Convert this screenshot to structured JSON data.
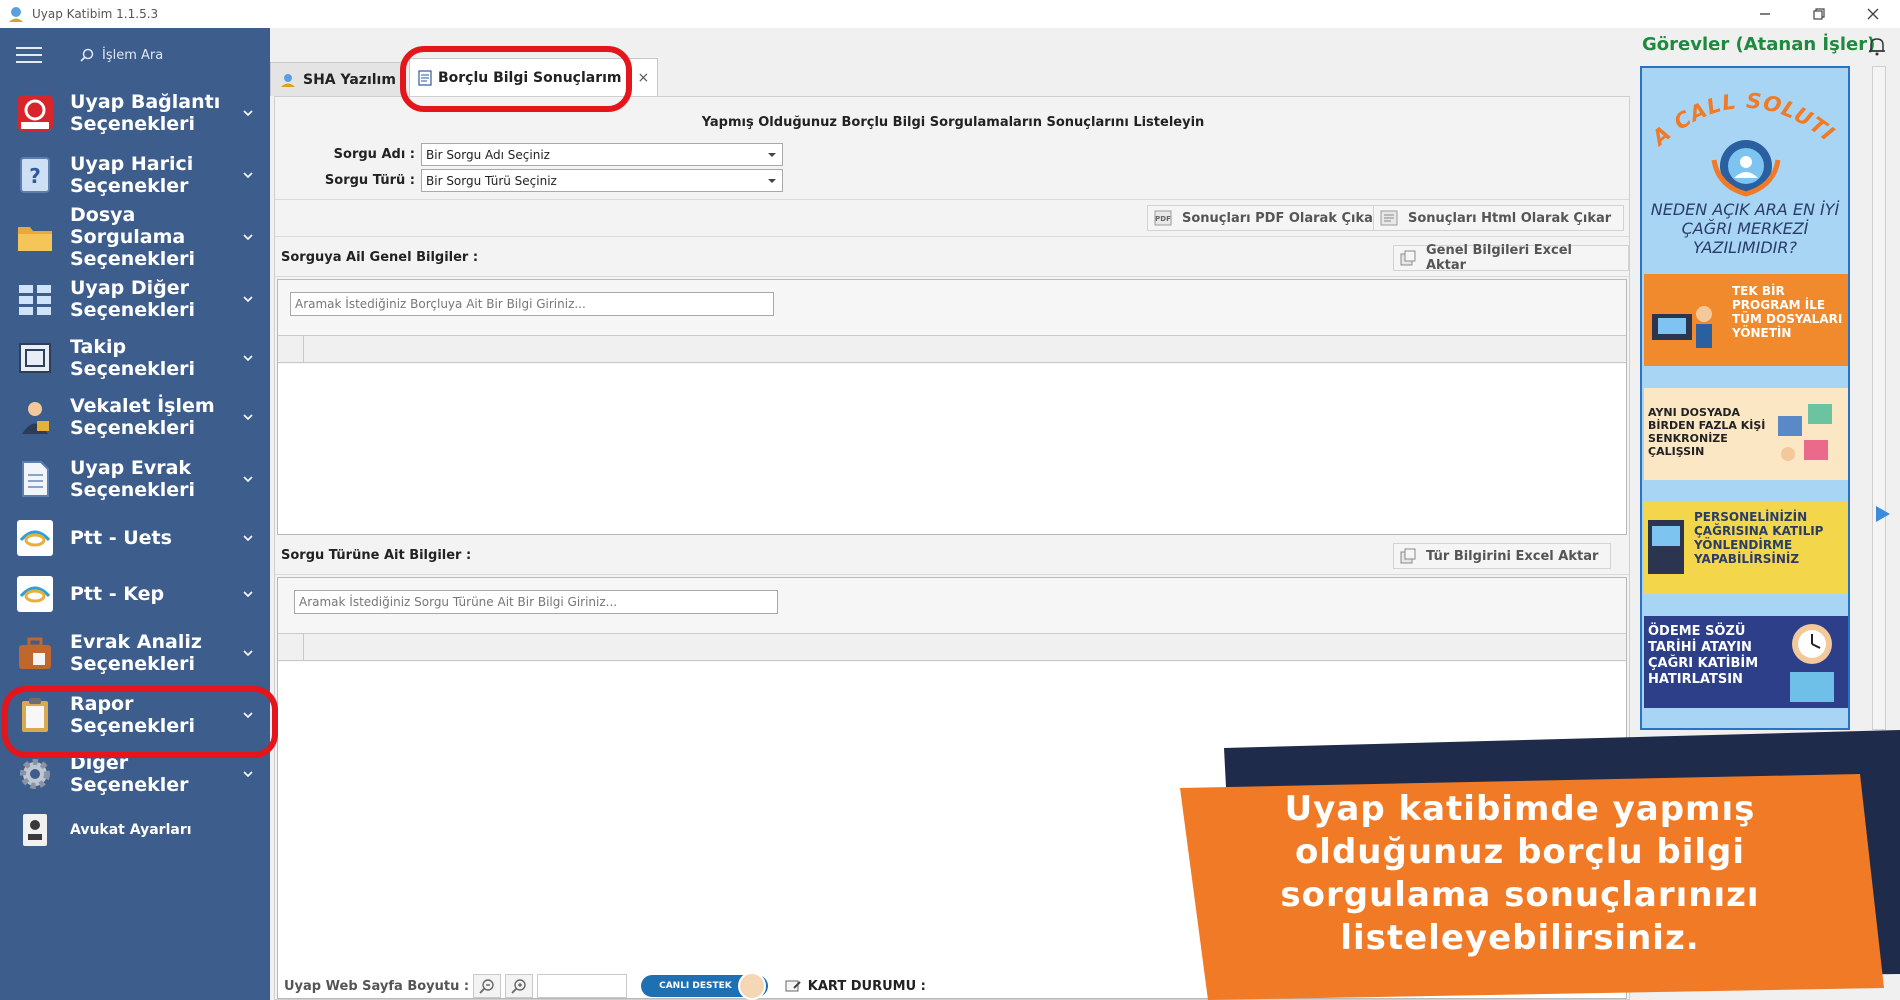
{
  "window": {
    "title": "Uyap Katibim 1.1.5.3"
  },
  "sidebar": {
    "search_placeholder": "İşlem Ara",
    "items": [
      {
        "label": "Uyap Bağlantı Seçenekleri",
        "icon": "uyap-logo-icon"
      },
      {
        "label": "Uyap Harici Seçenekler",
        "icon": "help-book-icon"
      },
      {
        "label": "Dosya Sorgulama Seçenekleri",
        "icon": "folder-icon"
      },
      {
        "label": "Uyap Diğer Seçenekleri",
        "icon": "grid-icon"
      },
      {
        "label": "Takip Seçenekleri",
        "icon": "frame-icon"
      },
      {
        "label": "Vekalet İşlem Seçenekleri",
        "icon": "lawyer-icon"
      },
      {
        "label": "Uyap Evrak Seçenekleri",
        "icon": "document-icon"
      },
      {
        "label": "Ptt - Uets",
        "icon": "ptt-icon"
      },
      {
        "label": "Ptt - Kep",
        "icon": "ptt-icon"
      },
      {
        "label": "Evrak Analiz Seçenekleri",
        "icon": "briefcase-icon"
      },
      {
        "label": "Rapor Seçenekleri",
        "icon": "clipboard-icon"
      },
      {
        "label": "Diğer Seçenekler",
        "icon": "gear-icon"
      },
      {
        "label": "Avukat Ayarları",
        "icon": "id-card-icon"
      }
    ]
  },
  "tabs": [
    {
      "label": "SHA Yazılım",
      "active": false
    },
    {
      "label": "Borçlu Bilgi Sonuçlarım",
      "active": true,
      "close": "×"
    }
  ],
  "form": {
    "heading": "Yapmış Olduğunuz Borçlu Bilgi Sorgulamaların Sonuçlarını Listeleyin",
    "query_name_label": "Sorgu Adı :",
    "query_name_value": "Bir Sorgu Adı Seçiniz",
    "query_type_label": "Sorgu Türü :",
    "query_type_value": "Bir Sorgu Türü Seçiniz"
  },
  "export": {
    "pdf_label": "Sonuçları PDF Olarak Çıkar",
    "html_label": "Sonuçları Html Olarak Çıkar"
  },
  "general_section": {
    "title": "Sorguya Ail Genel Bilgiler :",
    "excel_label": "Genel Bilgileri Excel Aktar",
    "search_placeholder": "Aramak İstediğiniz Borçluya Ait Bir Bilgi Giriniz..."
  },
  "type_section": {
    "title": "Sorgu Türüne Ait Bilgiler :",
    "excel_label": "Tür Bilgirini Excel Aktar",
    "search_placeholder": "Aramak İstediğiniz Sorgu Türüne Ait Bir Bilgi Giriniz..."
  },
  "status": {
    "zoom_label": "Uyap Web Sayfa Boyutu :",
    "live_support": "CANLI DESTEK",
    "card_status": "KART DURUMU :"
  },
  "tasks": {
    "title": "Görevler (Atanan İşler)"
  },
  "ads": {
    "brand": "TAA CALL SOLUTION",
    "question": "NEDEN AÇIK ARA EN İYİ ÇAĞRI MERKEZİ YAZILIMIDIR?",
    "card1": "TEK BİR PROGRAM İLE TÜM DOSYALARI YÖNETİN",
    "card2": "AYNI DOSYADA BİRDEN FAZLA KİŞİ SENKRONİZE ÇALIŞSIN",
    "card3": "PERSONELİNİZİN ÇAĞRISINA KATILIP YÖNLENDİRME YAPABİLİRSİNİZ",
    "card4": "ÖDEME SÖZÜ TARİHİ ATAYIN ÇAĞRI KATİBİM HATIRLATSIN"
  },
  "promo": {
    "text": "Uyap katibimde yapmış olduğunuz borçlu bilgi sorgulama sonuçlarınızı listeleyebilirsiniz."
  },
  "colors": {
    "sidebar": "#3d5d8c",
    "highlight": "#e5151c",
    "promo_orange": "#f07a26",
    "promo_navy": "#1f2b4a",
    "tasks_green": "#1f8a3f"
  }
}
